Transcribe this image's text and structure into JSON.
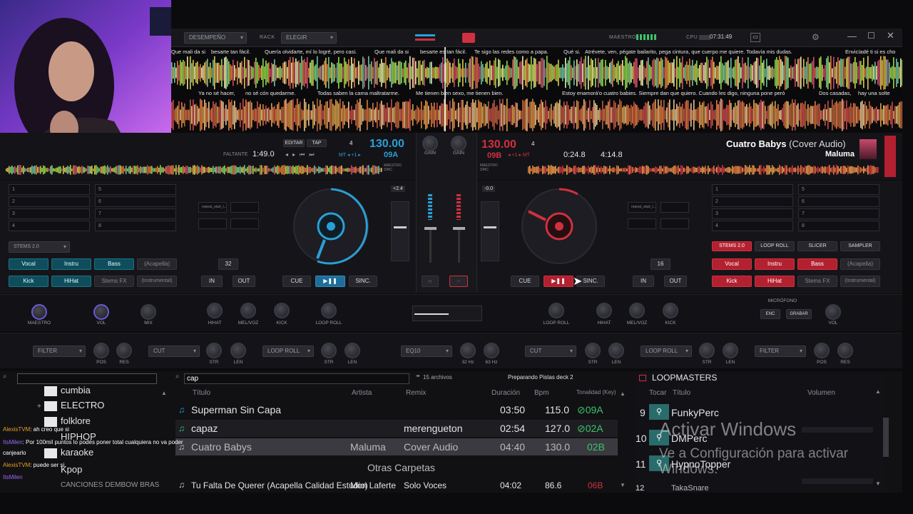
{
  "topbar": {
    "mode": "DESEMPEÑO",
    "rack_label": "RACK",
    "rack_value": "ELEGIR",
    "master_label": "MAESTRO",
    "cpu_label": "CPU",
    "clock": "07:31:49"
  },
  "waves": {
    "lyrics_top": [
      "Que mali da si",
      "besarte tan fácil.",
      "Quería olvidarte, mí lo logré, pero casi.",
      "Que mali da si",
      "besarte es tan fácil.",
      "Te sigo las redes como a papa.",
      "Qué si.",
      "Atrévete, ven, pégate bailarito, pega cintura, que cuerpo me quiere. Todavía mis dudas.",
      "Envicíadé ti si es cho"
    ],
    "lyrics_bottom": [
      "Ya no sé hacer,",
      "no sé cón quedarme.",
      "Todas saben la cama maltratarme.",
      "Me tienen bien sexo, me tienen bien.",
      "Estoy enamorá'o cuatro babies. Siempre dan que quiero. Cuando les digo, ninguna pone peró",
      "Dos casadas,",
      "hay una solte"
    ]
  },
  "deck_left": {
    "remaining_label": "FALTANTE",
    "time": "1:49.0",
    "bpm": "130.00",
    "key": "09A",
    "pitch": "+2.4",
    "edit_label": "EDITAR",
    "tap_label": "TAP",
    "master_sync": "MAESTRO SINC",
    "loop_size": "32",
    "in_label": "IN",
    "out_label": "OUT",
    "cue_label": "CUE",
    "sync_label": "SINC.",
    "stems_label": "STEMS 2.0",
    "stems": [
      "Vocal",
      "Instru",
      "Bass",
      "(Acapella)",
      "Kick",
      "HiHat",
      "Stems FX",
      "(Instrumental)"
    ],
    "hotcues": [
      "1",
      "2",
      "3",
      "4",
      "5",
      "6",
      "7",
      "8"
    ],
    "slot_label": "repeat_start_l..."
  },
  "deck_right": {
    "bpm": "130.00",
    "deck_num": "4",
    "key": "09B",
    "pitch": "-0.0",
    "elapsed": "0:24.8",
    "remaining": "4:14.8",
    "title": "Cuatro Babys",
    "remix": "(Cover Audio)",
    "artist": "Maluma",
    "master_sync": "MAESTRO SINC",
    "loop_size": "16",
    "in_label": "IN",
    "out_label": "OUT",
    "cue_label": "CUE",
    "sync_label": "SINC.",
    "pad_modes": [
      "STEMS 2.0",
      "LOOP ROLL",
      "SLICER",
      "SAMPLER"
    ],
    "stems": [
      "Vocal",
      "Instru",
      "Bass",
      "(Acapella)",
      "Kick",
      "HiHat",
      "Stems FX",
      "(Instrumental)"
    ],
    "hotcues": [
      "1",
      "2",
      "3",
      "4",
      "5",
      "6",
      "7",
      "8"
    ],
    "slot_label": "repeat_start_l..."
  },
  "mixer": {
    "gain_left": "GAIN",
    "gain_right": "GAIN"
  },
  "fx_row": {
    "left_knobs": [
      "MAESTRO",
      "VOL",
      "MIX"
    ],
    "left_deck_knobs": [
      "HIHAT",
      "MEL/VOZ",
      "KICK",
      "LOOP ROLL"
    ],
    "right_deck_knobs": [
      "LOOP ROLL",
      "HIHAT",
      "MEL/VOZ",
      "KICK"
    ],
    "mic_label": "MICRÓFONO",
    "mic_enc": "ENC",
    "mic_record": "GRABAR",
    "mic_vol": "VOL"
  },
  "filter_row": {
    "left_filter": "FILTER",
    "left_cut": "CUT",
    "left_loop_roll": "LOOP ROLL",
    "eq": "EQ10",
    "right_cut": "CUT",
    "right_loop_roll": "LOOP ROLL",
    "right_filter": "FILTER",
    "pos": "POS",
    "res": "RES",
    "str": "STR",
    "len": "LEN",
    "hz32": "32 Hz",
    "hz63": "63 Hz"
  },
  "browser": {
    "search_value": "cap",
    "file_count": "15 archivos",
    "status": "Preparando Pistas deck 2",
    "columns": [
      "Título",
      "Artista",
      "Remix",
      "Duración",
      "Bpm",
      "Tonalidad (Key)"
    ],
    "tracks": [
      {
        "title": "Superman Sin Capa",
        "artist": "",
        "remix": "",
        "duration": "03:50",
        "bpm": "115.0",
        "key": "09A"
      },
      {
        "title": "capaz",
        "artist": "",
        "remix": "merengueton",
        "duration": "02:54",
        "bpm": "127.0",
        "key": "02A"
      },
      {
        "title": "Cuatro Babys",
        "artist": "Maluma",
        "remix": "Cover Audio",
        "duration": "04:40",
        "bpm": "130.0",
        "key": "02B"
      },
      {
        "title": "Tu Falta De Querer (Acapella Calidad Estudio)",
        "artist": "Mon Laferte",
        "remix": "Solo Voces",
        "duration": "04:02",
        "bpm": "86.6",
        "key": "06B"
      }
    ],
    "other_folders": "Otras Carpetas",
    "folders": [
      "cumbia",
      "ELECTRO",
      "folklore",
      "HIPHOP",
      "karaoke",
      "Kpop",
      "CANCIONES DEMBOW BRAS"
    ]
  },
  "sampler": {
    "title": "LOOPMASTERS",
    "col_play": "Tocar",
    "col_title": "Título",
    "col_volume": "Volumen",
    "items": [
      {
        "num": "9",
        "name": "FunkyPerc"
      },
      {
        "num": "10",
        "name": "DMPerc"
      },
      {
        "num": "11",
        "name": "HypnoTopper"
      },
      {
        "num": "12",
        "name": "TakaSnare"
      }
    ]
  },
  "chat": [
    {
      "user": "AlexisTVM",
      "msg": ": ah creo que si"
    },
    {
      "user": "ItsMilen",
      "msg": ": Por 100mil puntos lo podés poner total cualquiera no va poder"
    },
    {
      "user": "",
      "msg": "canjearlo"
    },
    {
      "user": "AlexisTVM",
      "msg": ": puede ser si"
    },
    {
      "user": "ItsMilen",
      "msg": ""
    }
  ],
  "watermark": {
    "line1": "Activar Windows",
    "line2": "Ve a Configuración para activar",
    "line3": "Windows."
  },
  "colors": {
    "accent_blue": "#2a9fd6",
    "accent_red": "#d0303f",
    "key_green": "#3cc26b"
  }
}
